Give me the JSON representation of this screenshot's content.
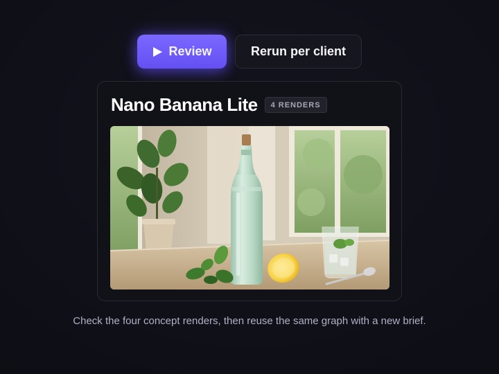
{
  "actions": {
    "review_label": "Review",
    "rerun_label": "Rerun per client"
  },
  "card": {
    "title": "Nano Banana Lite",
    "badge": "4 RENDERS",
    "image_icon": "product-render-photo"
  },
  "caption": "Check the four concept renders, then reuse the same graph with a new brief.",
  "colors": {
    "accent": "#6c5cff",
    "background": "#0e0e16",
    "card": "#111118",
    "caption_text": "#b0b0c6"
  }
}
